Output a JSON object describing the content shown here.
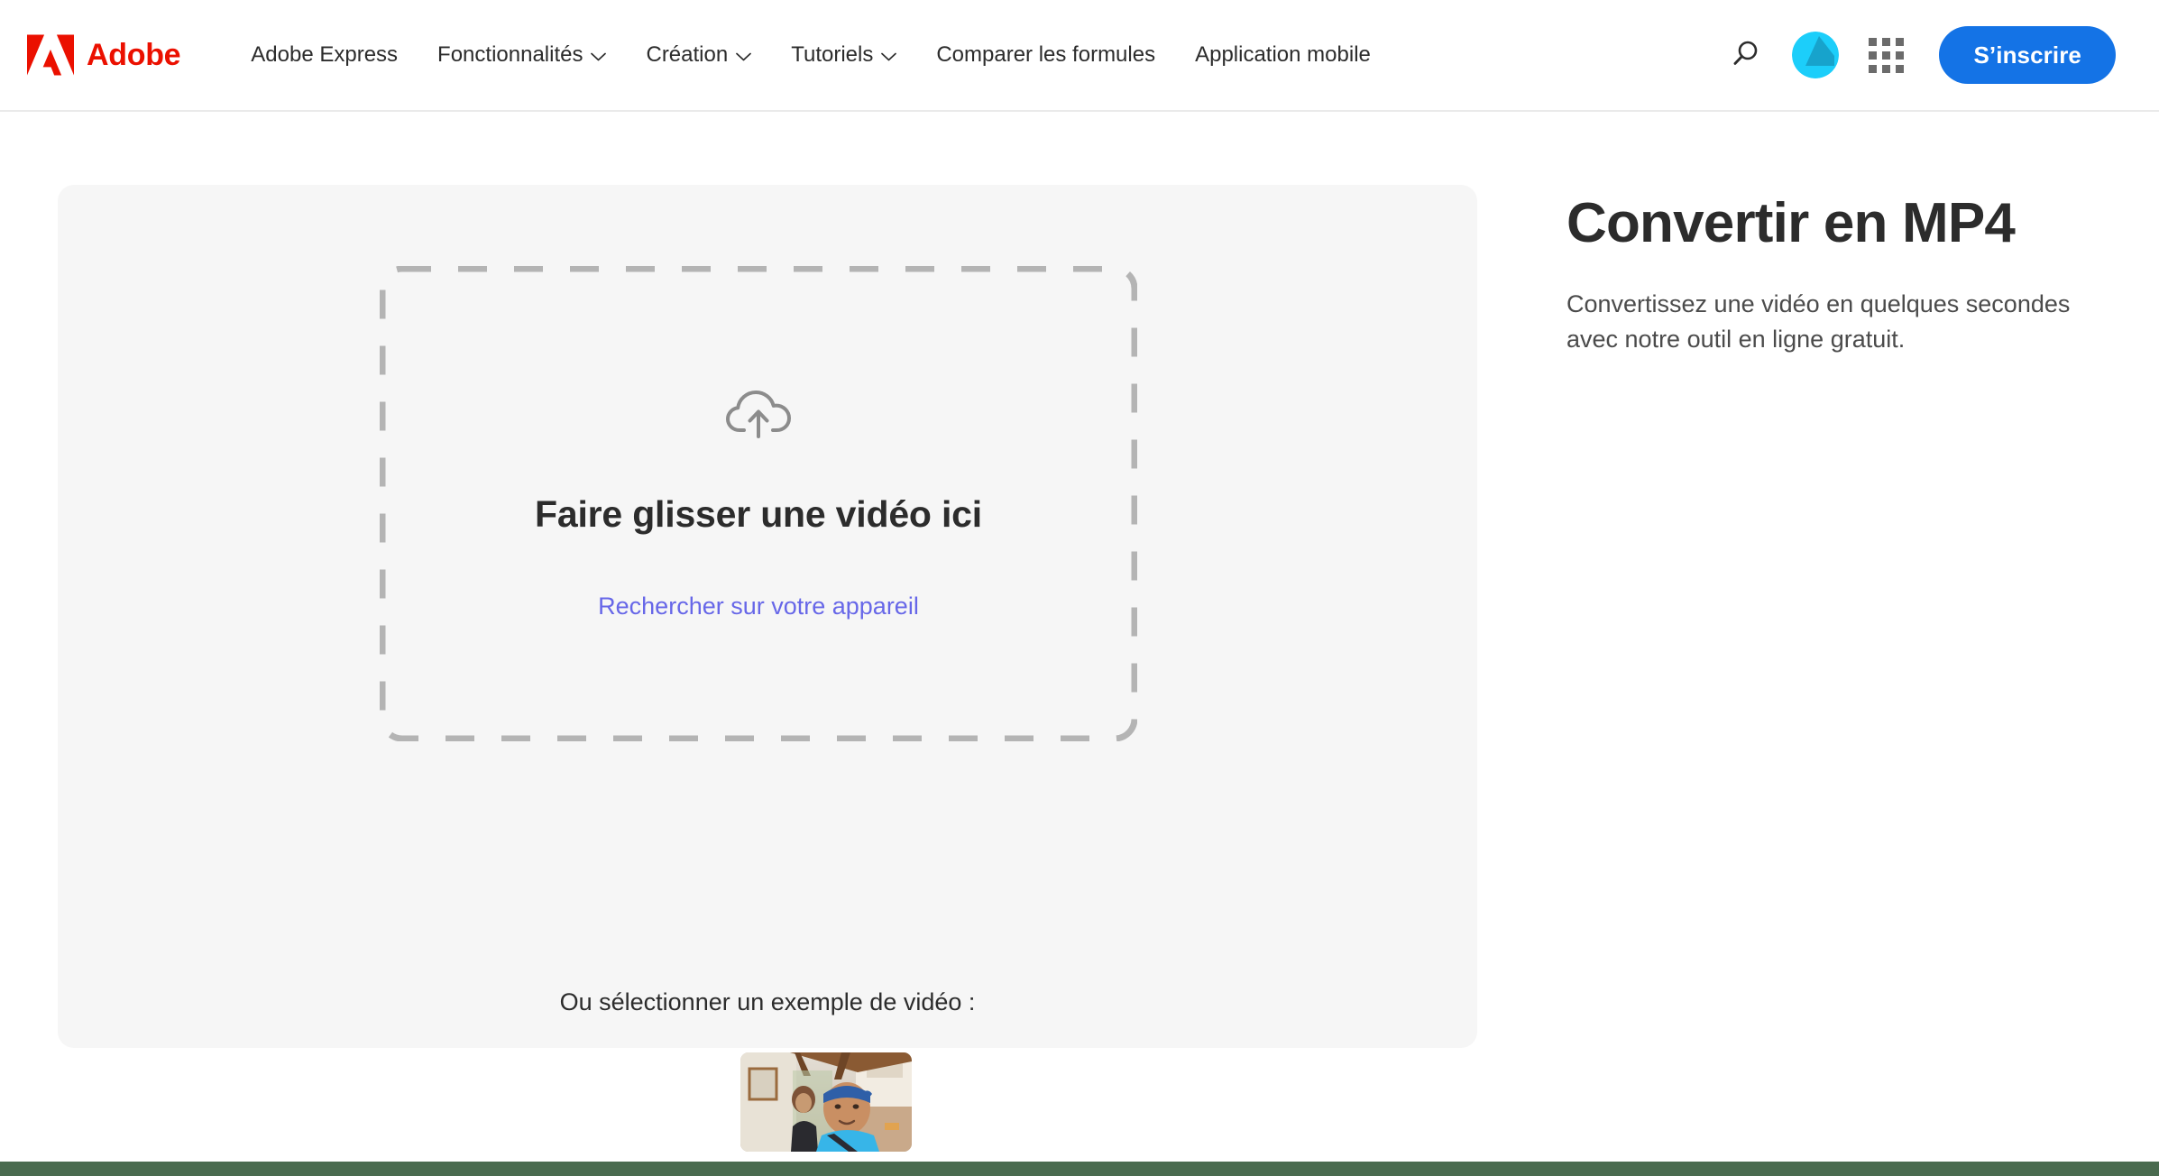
{
  "header": {
    "brand": {
      "name": "Adobe",
      "logo_icon": "adobe-logo-icon",
      "logo_color": "#eb1000"
    },
    "nav": [
      {
        "label": "Adobe Express",
        "has_dropdown": false
      },
      {
        "label": "Fonctionnalités",
        "has_dropdown": true
      },
      {
        "label": "Création",
        "has_dropdown": true
      },
      {
        "label": "Tutoriels",
        "has_dropdown": true
      },
      {
        "label": "Comparer les formules",
        "has_dropdown": false
      },
      {
        "label": "Application mobile",
        "has_dropdown": false
      }
    ],
    "search_icon": "search-icon",
    "avatar_icon": "adobe-express-avatar-icon",
    "avatar_colors": {
      "circle": "#1ccefa",
      "wedge": "#17a3cc"
    },
    "app_switcher_icon": "app-grid-icon",
    "signup_label": "S’inscrire",
    "signup_color": "#1473e6"
  },
  "upload": {
    "dropzone": {
      "upload_icon": "cloud-upload-icon",
      "title": "Faire glisser une vidéo ici",
      "browse_link": "Rechercher sur votre appareil",
      "link_color": "#6767e8",
      "border_color": "#b4b4b4"
    },
    "sample_label": "Ou sélectionner un exemple de vidéo :",
    "sample_thumbnail_name": "sample-video-thumbnail",
    "card_color": "#f6f6f6"
  },
  "info": {
    "title": "Convertir en MP4",
    "subtitle": "Convertissez une vidéo en quelques secondes avec notre outil en ligne gratuit."
  },
  "footer": {
    "band_color": "#4a6b4f"
  }
}
